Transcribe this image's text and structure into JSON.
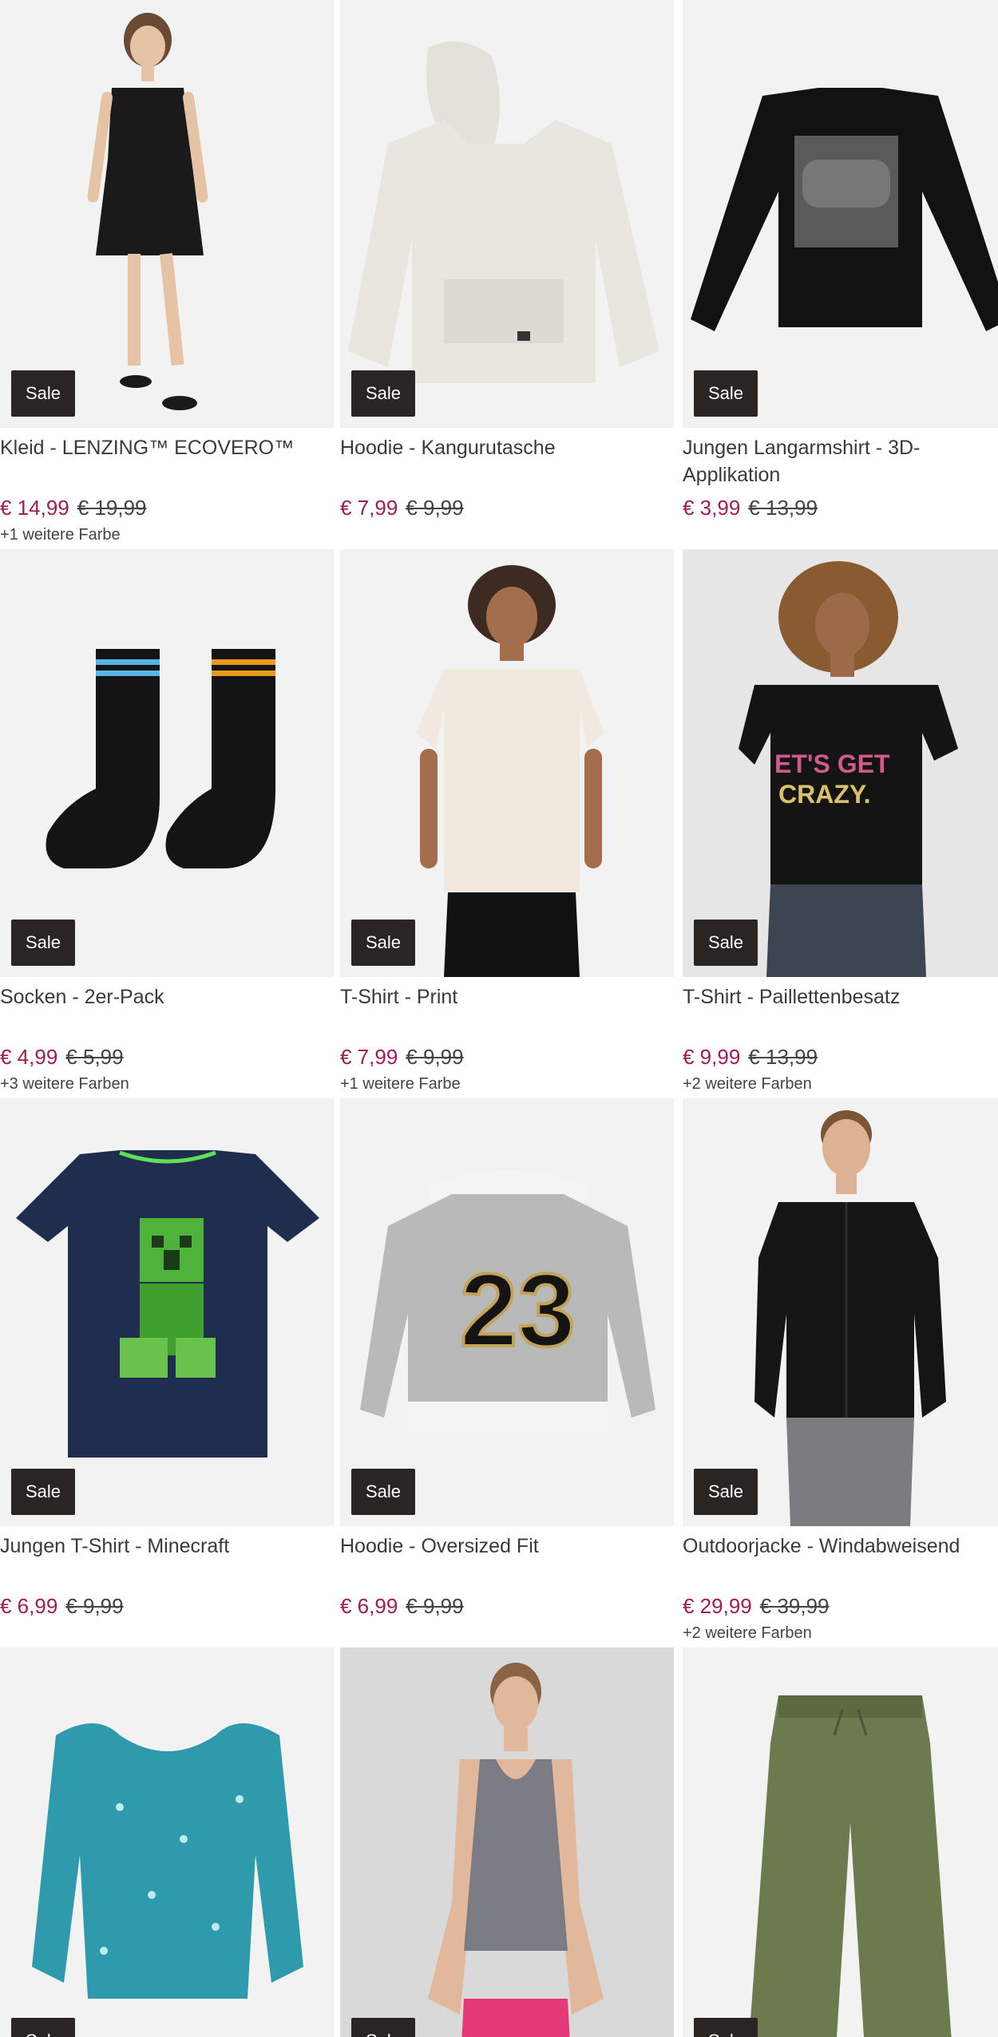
{
  "badge_label": "Sale",
  "colors": {
    "price_sale": "#a01d55",
    "badge_bg": "#2a2523"
  },
  "products": [
    {
      "title": "Kleid - LENZING™ ECOVERO™",
      "price": "€ 14,99",
      "old_price": "€ 19,99",
      "more_colors": "+1 weitere Farbe",
      "image": "black-dress-model"
    },
    {
      "title": "Hoodie - Kangurutasche",
      "price": "€ 7,99",
      "old_price": "€ 9,99",
      "more_colors": "",
      "image": "beige-hoodie"
    },
    {
      "title": "Jungen Langarmshirt - 3D-Applikation",
      "price": "€ 3,99",
      "old_price": "€ 13,99",
      "more_colors": "",
      "image": "black-longsleeve-gaming"
    },
    {
      "title": "Socken - 2er-Pack",
      "price": "€ 4,99",
      "old_price": "€ 5,99",
      "more_colors": "+3 weitere Farben",
      "image": "black-socks"
    },
    {
      "title": "T-Shirt - Print",
      "price": "€ 7,99",
      "old_price": "€ 9,99",
      "more_colors": "+1 weitere Farbe",
      "image": "cream-tshirt-model"
    },
    {
      "title": "T-Shirt - Paillettenbesatz",
      "price": "€ 9,99",
      "old_price": "€ 13,99",
      "more_colors": "+2 weitere Farben",
      "image": "black-tshirt-sequins-model"
    },
    {
      "title": "Jungen T-Shirt - Minecraft",
      "price": "€ 6,99",
      "old_price": "€ 9,99",
      "more_colors": "",
      "image": "navy-minecraft-tshirt"
    },
    {
      "title": "Hoodie - Oversized Fit",
      "price": "€ 6,99",
      "old_price": "€ 9,99",
      "more_colors": "",
      "image": "grey-hoodie-23"
    },
    {
      "title": "Outdoorjacke - Windabweisend",
      "price": "€ 29,99",
      "old_price": "€ 39,99",
      "more_colors": "+2 weitere Farben",
      "image": "black-jacket-model"
    },
    {
      "title": "",
      "price": "",
      "old_price": "",
      "more_colors": "",
      "image": "teal-floral-blouse"
    },
    {
      "title": "",
      "price": "",
      "old_price": "",
      "more_colors": "",
      "image": "grey-tanktop-model"
    },
    {
      "title": "",
      "price": "",
      "old_price": "",
      "more_colors": "",
      "image": "olive-trousers"
    }
  ]
}
